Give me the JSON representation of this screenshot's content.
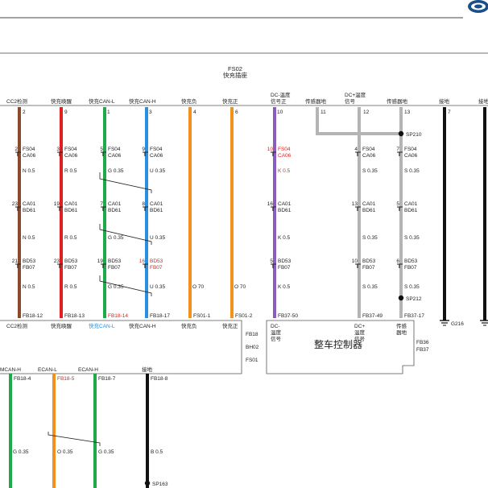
{
  "header": {
    "connector_id": "FS02",
    "connector_name": "快充插座"
  },
  "pins": [
    {
      "label": "CC2检测",
      "pin": "2"
    },
    {
      "label": "快充唤醒",
      "pin": "9"
    },
    {
      "label": "快充CAN-L",
      "pin": "1"
    },
    {
      "label": "快充CAN-H",
      "pin": "3"
    },
    {
      "label": "快充负",
      "pin": "4"
    },
    {
      "label": "快充正",
      "pin": "6"
    },
    {
      "label": "DC-温度信号正",
      "pin": "10"
    },
    {
      "label": "传感器地",
      "pin": "11"
    },
    {
      "label": "DC+温度信号",
      "pin": "12"
    },
    {
      "label": "传感器地",
      "pin": "13"
    },
    {
      "label": "接地",
      "pin": "7"
    },
    {
      "label": "接地",
      "pin": ""
    }
  ],
  "connectors": {
    "fs04": "FS04",
    "ca06": "CA06",
    "ca01": "CA01",
    "bd61": "BD61",
    "bd53": "BD53",
    "fb07": "FB07"
  },
  "wires": {
    "w_cc2": "N 0.5",
    "w_wake": "R 0.5",
    "w_canl": "G 0.35",
    "w_canh": "U 0.35",
    "w_neg": "O 70",
    "w_pos": "O 70",
    "w_dcm": "K 0.5",
    "w_dcp": "S 0.35",
    "w_sg": "S 0.35"
  },
  "pin_numbers": {
    "fs04": [
      "2",
      "3",
      "5",
      "9",
      "10",
      "4",
      "7"
    ],
    "ca01": [
      "23",
      "19",
      "7",
      "8",
      "16",
      "13",
      "5"
    ],
    "bd53": [
      "21",
      "23",
      "19",
      "16",
      "5",
      "10",
      "6"
    ]
  },
  "splices": {
    "sp210": "SP210",
    "sp212": "SP212",
    "sp163": "SP163"
  },
  "ground": {
    "g216": "G216"
  },
  "terminals": [
    "FB18-12",
    "FB18-13",
    "FB18-14",
    "FB18-17",
    "FS01-1",
    "FS01-2",
    "FB37-50",
    "FB37-49",
    "FB37-17"
  ],
  "bottom_labels": {
    "cc2": "CC2检测",
    "wake": "快充唤醒",
    "canl": "快充CAN-L",
    "canh": "快充CAN-H",
    "neg": "快充负",
    "pos": "快充正",
    "dcm": [
      "DC-",
      "温度",
      "信号"
    ],
    "dcp": [
      "DC+",
      "温度",
      "信号"
    ],
    "sg": [
      "传感",
      "器地"
    ]
  },
  "box_ids": {
    "fb18": "FB18",
    "bh02": "BH02",
    "fs01": "FS01",
    "fb36": "FB36",
    "fb37": "FB37"
  },
  "vcu": {
    "name": "整车控制器"
  },
  "lower": {
    "labels": [
      "MCAN-H",
      "ECAN-L",
      "ECAN-H",
      "接地"
    ],
    "terminals": [
      "FB18-4",
      "FB18-5",
      "FB18-7",
      "FB18-8"
    ],
    "wires": [
      "G 0.35",
      "O 0.35",
      "G 0.35",
      "B 0.5"
    ]
  },
  "colors": {
    "brown": "#8b4a2b",
    "red": "#e02020",
    "green": "#1faa4a",
    "blue": "#2a8fe0",
    "orange": "#f2921c",
    "purple": "#8a5cc2",
    "gray": "#b4b4b4",
    "black": "#111111"
  }
}
